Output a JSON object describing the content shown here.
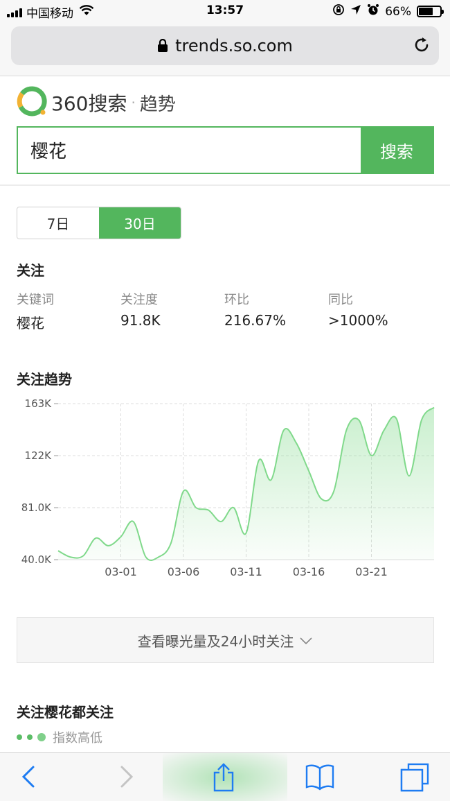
{
  "status_bar": {
    "carrier": "中国移动",
    "time": "13:57",
    "battery": "66%",
    "battery_level": 0.66
  },
  "browser": {
    "url": "trends.so.com"
  },
  "header": {
    "brand": "360搜索",
    "separator": "·",
    "subtitle": "趋势"
  },
  "search": {
    "value": "樱花",
    "button_label": "搜索"
  },
  "range_tabs": [
    {
      "label": "7日",
      "active": false
    },
    {
      "label": "30日",
      "active": true
    }
  ],
  "attention": {
    "title": "关注",
    "columns": [
      {
        "label": "关键词",
        "value": "樱花"
      },
      {
        "label": "关注度",
        "value": "91.8K"
      },
      {
        "label": "环比",
        "value": "216.67%"
      },
      {
        "label": "同比",
        "value": ">1000%"
      }
    ]
  },
  "trend": {
    "title": "关注趋势"
  },
  "chart_data": {
    "type": "area",
    "y_tick_labels": [
      "163K",
      "122K",
      "81.0K",
      "40.0K"
    ],
    "y_ticks": [
      163000,
      122000,
      81000,
      40000
    ],
    "ylim": [
      40000,
      163000
    ],
    "x_tick_labels": [
      "03-01",
      "03-06",
      "03-11",
      "03-16",
      "03-21"
    ],
    "x_ticks": [
      5,
      10,
      15,
      20,
      25
    ],
    "x": [
      0,
      1,
      2,
      3,
      4,
      5,
      6,
      7,
      8,
      9,
      10,
      11,
      12,
      13,
      14,
      15,
      16,
      17,
      18,
      19,
      20,
      21,
      22,
      23,
      24,
      25,
      26,
      27,
      28,
      29,
      30
    ],
    "values": [
      47000,
      42000,
      43000,
      57000,
      51000,
      58000,
      70000,
      42000,
      42000,
      53000,
      94000,
      81000,
      79000,
      70000,
      81000,
      61000,
      118000,
      103000,
      142000,
      132000,
      110000,
      88000,
      94000,
      142000,
      150000,
      122000,
      142000,
      151000,
      106000,
      150000,
      160000
    ],
    "color": "#80d98b",
    "grid": true
  },
  "expand_button": {
    "label": "查看曝光量及24小时关注"
  },
  "related": {
    "title": "关注樱花都关注",
    "legend_label": "指数高低"
  }
}
